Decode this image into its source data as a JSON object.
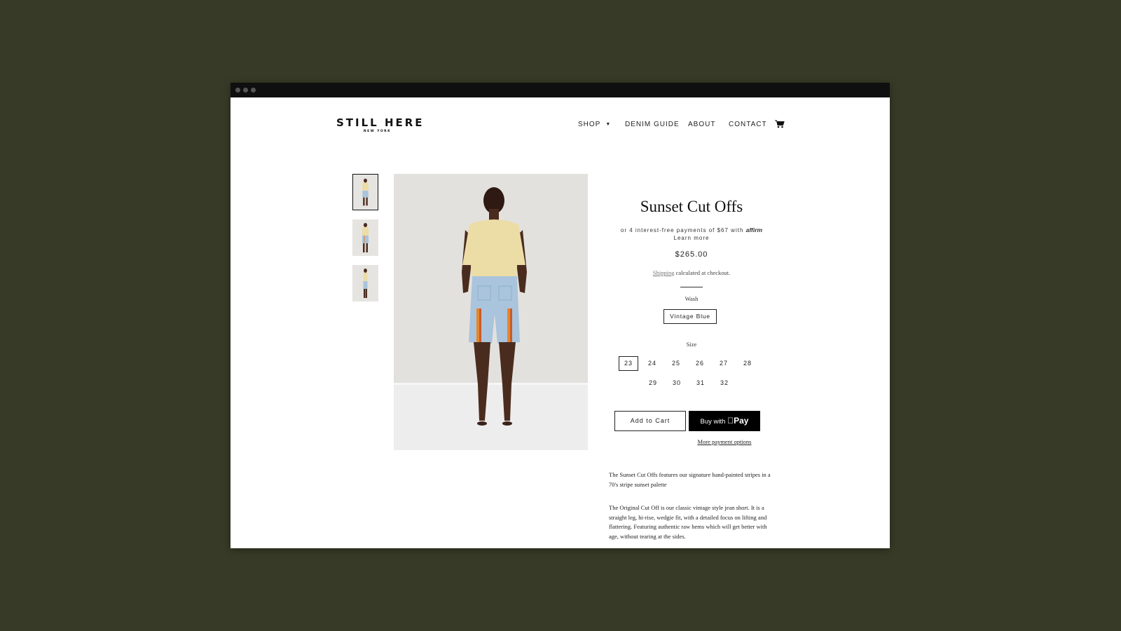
{
  "site": {
    "logo_main": "STILL HERE",
    "logo_sub": "NEW YORK"
  },
  "nav": {
    "items": [
      {
        "label": "SHOP"
      },
      {
        "label": "DENIM GUIDE"
      },
      {
        "label": "ABOUT"
      },
      {
        "label": "CONTACT"
      }
    ],
    "cart_icon": "shopping-cart-icon",
    "shop_dropdown_icon": "caret-down-icon"
  },
  "product": {
    "title": "Sunset Cut Offs",
    "affirm_text": "or 4 interest-free payments of $67 with",
    "affirm_logo": "affirm",
    "learn_more": "Learn more",
    "price": "$265.00",
    "shipping_link": "Shipping",
    "shipping_rest": "calculated at checkout.",
    "wash_label": "Wash",
    "wash_value": "Vintage Blue",
    "size_label": "Size",
    "sizes": [
      "23",
      "24",
      "25",
      "26",
      "27",
      "28",
      "29",
      "30",
      "31",
      "32"
    ],
    "selected_size": "23",
    "add_to_cart": "Add to Cart",
    "buy_with": "Buy with",
    "pay_brand": "Pay",
    "more_payment": "More payment options",
    "description": [
      "The Sunset Cut Offs features our signature hand-painted stripes in a 70's stripe sunset palette",
      "The Original Cut Off is our classic vintage style jean short. It is a straight leg, hi-rise, wedgie fit, with a detailed focus on lifting and flattering. Featuring authentic raw hems which will get better with age, without tearing at the sides."
    ]
  },
  "colors": {
    "background": "#373a26",
    "titlebar": "#0f0f0f",
    "shirt": "#ecdca6",
    "denim": "#a9c4dc",
    "stripe_orange": "#e8862a",
    "stripe_red": "#c95a2a",
    "skin": "#4a2c1e"
  }
}
